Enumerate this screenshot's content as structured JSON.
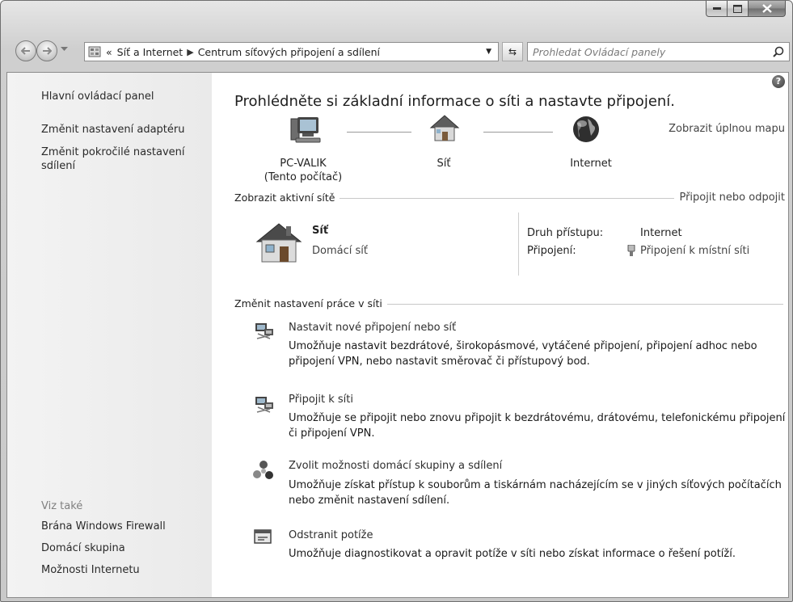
{
  "breadcrumb": {
    "overflow": "«",
    "items": [
      "Síť a Internet",
      "Centrum síťových připojení a sdílení"
    ]
  },
  "search": {
    "placeholder": "Prohledat Ovládací panely"
  },
  "sidebar": {
    "links": [
      "Hlavní ovládací panel",
      "Změnit nastavení adaptéru",
      "Změnit pokročilé nastavení sdílení"
    ],
    "see_also_heading": "Viz také",
    "see_also": [
      "Brána Windows Firewall",
      "Domácí skupina",
      "Možnosti Internetu"
    ]
  },
  "main": {
    "title": "Prohlédněte si základní informace o síti a nastavte připojení.",
    "full_map_link": "Zobrazit úplnou mapu",
    "map_nodes": [
      {
        "label": "PC-VALIK",
        "sub": "(Tento počítač)",
        "icon": "computer-icon"
      },
      {
        "label": "Síť",
        "icon": "home-network-icon"
      },
      {
        "label": "Internet",
        "icon": "globe-icon"
      }
    ],
    "active_networks": {
      "heading": "Zobrazit aktivní sítě",
      "connect_link": "Připojit nebo odpojit",
      "network_name": "Síť",
      "network_type": "Domácí síť",
      "access_label": "Druh přístupu:",
      "access_value": "Internet",
      "connections_label": "Připojení:",
      "connections_value": "Připojení k místní síti"
    },
    "change_settings_heading": "Změnit nastavení práce v síti",
    "tasks": [
      {
        "title": "Nastavit nové připojení nebo síť",
        "desc": "Umožňuje nastavit bezdrátové, širokopásmové, vytáčené připojení, připojení adhoc nebo připojení VPN, nebo nastavit směrovač či přístupový bod.",
        "icon": "network-setup-icon"
      },
      {
        "title": "Připojit k síti",
        "desc": "Umožňuje se připojit nebo znovu připojit k bezdrátovému, drátovému, telefonickému připojení či připojení VPN.",
        "icon": "connect-network-icon"
      },
      {
        "title": "Zvolit možnosti domácí skupiny a sdílení",
        "desc": "Umožňuje získat přístup k souborům a tiskárnám nacházejícím se v jiných síťových počítačích nebo změnit nastavení sdílení.",
        "icon": "homegroup-icon"
      },
      {
        "title": "Odstranit potíže",
        "desc": "Umožňuje diagnostikovat a opravit potíže v síti nebo získat informace o řešení potíží.",
        "icon": "troubleshoot-icon"
      }
    ]
  }
}
